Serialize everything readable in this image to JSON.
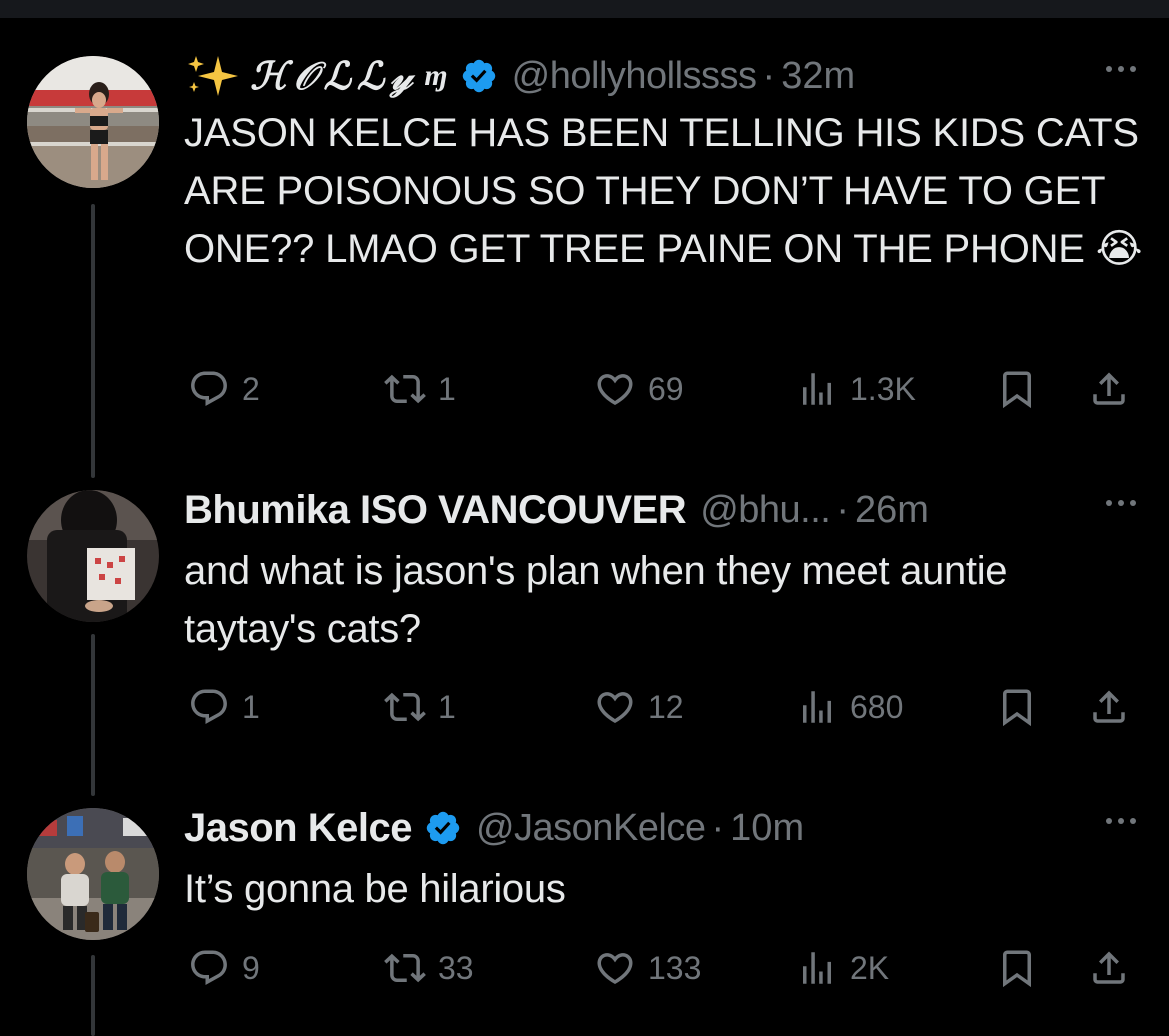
{
  "colors": {
    "background": "#000000",
    "text_primary": "#e7e9ea",
    "text_secondary": "#71767b",
    "verified_blue": "#1d9bf0",
    "thread_line": "#333639"
  },
  "tweets": [
    {
      "name": "✨𝓗𝓞𝓛𝓛𝓨",
      "name_display": "ℋ𝒪ℒℒ𝓎",
      "name_suffix": "ɱ",
      "verified": true,
      "handle": "@hollyhollssss",
      "separator": "·",
      "time": "32m",
      "text": "JASON KELCE HAS BEEN TELLING HIS KIDS CATS ARE POISONOUS SO THEY DON’T HAVE TO GET ONE?? LMAO GET TREE PAINE ON THE PHONE 😭",
      "actions": {
        "replies": "2",
        "reposts": "1",
        "likes": "69",
        "views": "1.3K"
      },
      "icons": [
        "reply-icon",
        "repost-icon",
        "like-icon",
        "views-icon",
        "bookmark-icon",
        "share-icon"
      ]
    },
    {
      "name": "Bhumika ISO VANCOUVER",
      "verified": false,
      "handle": "@bhu...",
      "separator": "·",
      "time": "26m",
      "text": "and what is jason's plan when they meet auntie taytay's cats?",
      "actions": {
        "replies": "1",
        "reposts": "1",
        "likes": "12",
        "views": "680"
      }
    },
    {
      "name": "Jason Kelce",
      "verified": true,
      "handle": "@JasonKelce",
      "separator": "·",
      "time": "10m",
      "text": "It’s gonna be hilarious",
      "actions": {
        "replies": "9",
        "reposts": "33",
        "likes": "133",
        "views": "2K"
      }
    }
  ]
}
